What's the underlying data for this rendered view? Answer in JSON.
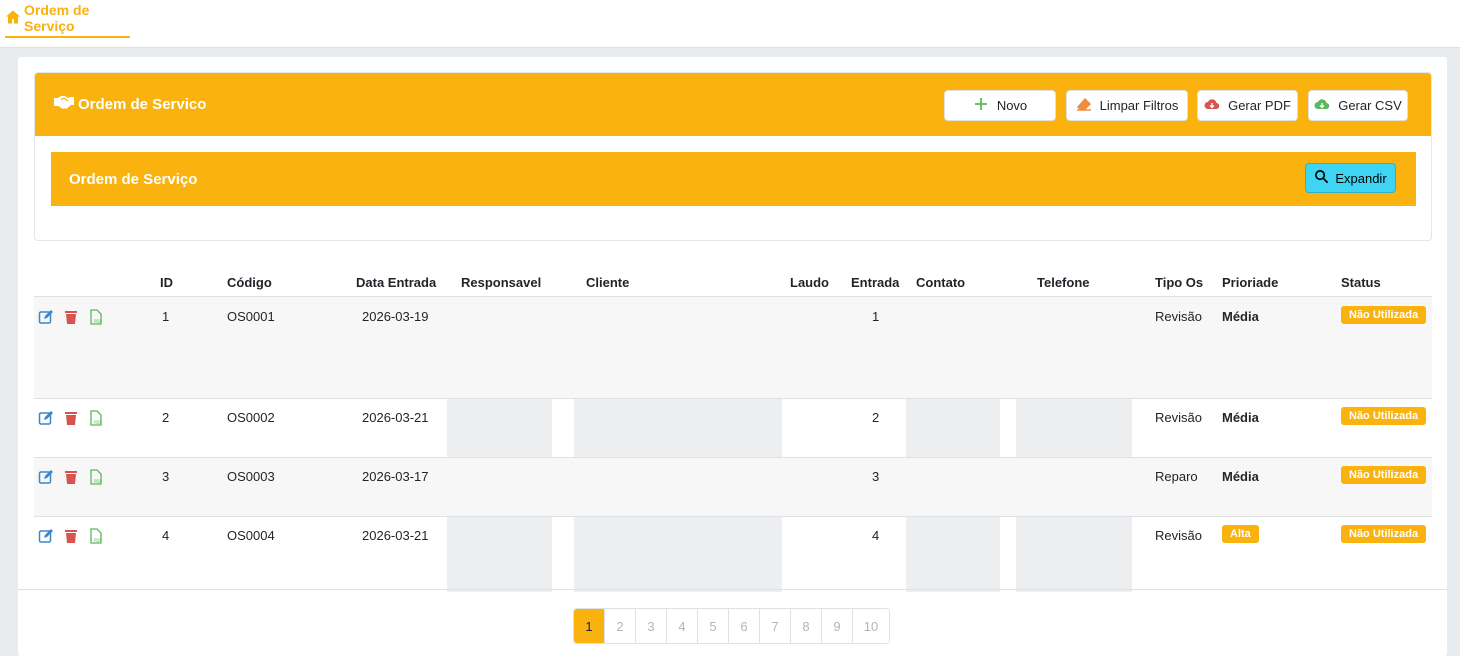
{
  "topbar": {
    "tab_label": "Ordem de Serviço",
    "tab_icon": "home-icon"
  },
  "panel": {
    "title": "Ordem de Servico",
    "buttons": {
      "novo": "Novo",
      "limpar": "Limpar Filtros",
      "pdf": "Gerar PDF",
      "csv": "Gerar CSV"
    }
  },
  "filter": {
    "title": "Ordem de Serviço",
    "expand_label": "Expandir"
  },
  "table": {
    "headers": {
      "id": "ID",
      "codigo": "Código",
      "data_entrada": "Data Entrada",
      "responsavel": "Responsavel",
      "cliente": "Cliente",
      "laudo": "Laudo",
      "entrada": "Entrada",
      "contato": "Contato",
      "telefone": "Telefone",
      "tipo_os": "Tipo Os",
      "prioridade": "Prioriade",
      "status": "Status"
    },
    "rows": [
      {
        "id": "1",
        "codigo": "OS0001",
        "data_entrada": "2026-03-19",
        "entrada": "1",
        "tipo_os": "Revisão",
        "prioridade": "Média",
        "status": "Não Utilizada"
      },
      {
        "id": "2",
        "codigo": "OS0002",
        "data_entrada": "2026-03-21",
        "entrada": "2",
        "tipo_os": "Revisão",
        "prioridade": "Média",
        "status": "Não Utilizada"
      },
      {
        "id": "3",
        "codigo": "OS0003",
        "data_entrada": "2026-03-17",
        "entrada": "3",
        "tipo_os": "Reparo",
        "prioridade": "Média",
        "status": "Não Utilizada"
      },
      {
        "id": "4",
        "codigo": "OS0004",
        "data_entrada": "2026-03-21",
        "entrada": "4",
        "tipo_os": "Revisão",
        "prioridade": "Alta",
        "status": "Não Utilizada"
      }
    ]
  },
  "pagination": {
    "pages": [
      "1",
      "2",
      "3",
      "4",
      "5",
      "6",
      "7",
      "8",
      "9",
      "10"
    ],
    "current": "1"
  },
  "colors": {
    "accent": "#f9b20e",
    "expand": "#3dd5f3",
    "edit": "#3a86c8",
    "delete": "#d9534f",
    "pdf": "#5cb85c"
  }
}
